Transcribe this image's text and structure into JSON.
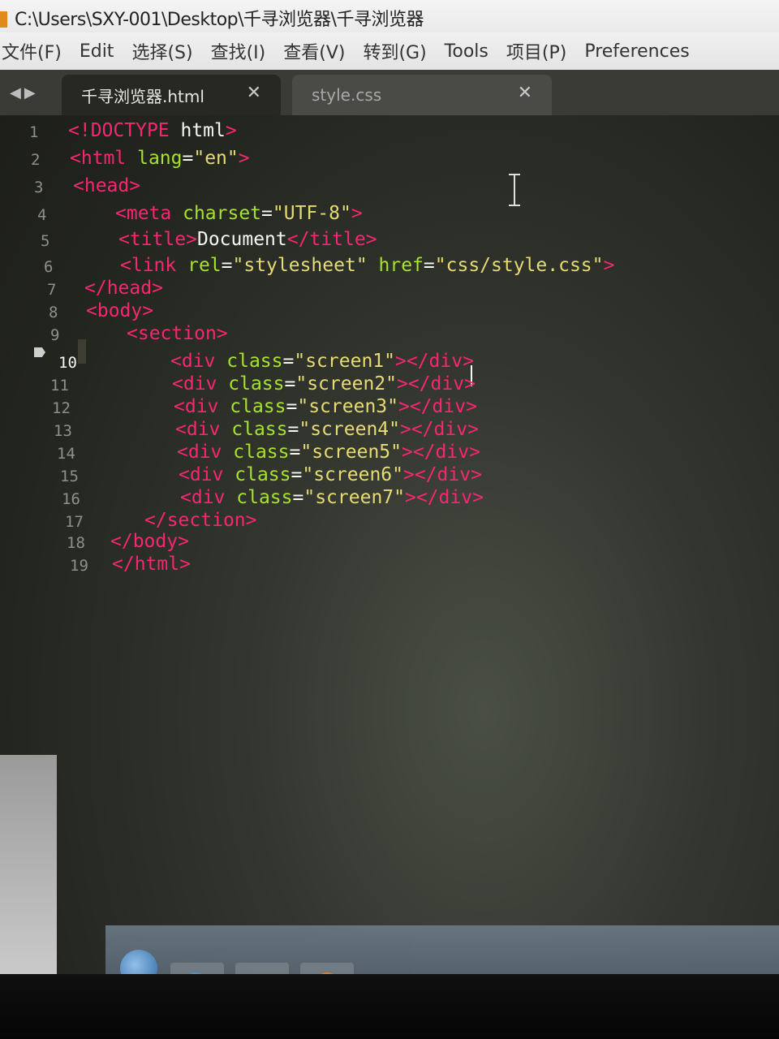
{
  "window": {
    "title": "C:\\Users\\SXY-001\\Desktop\\千寻浏览器\\千寻浏览器"
  },
  "menubar": {
    "items": [
      {
        "label": "文件(F)"
      },
      {
        "label": "Edit"
      },
      {
        "label": "选择(S)"
      },
      {
        "label": "查找(I)"
      },
      {
        "label": "查看(V)"
      },
      {
        "label": "转到(G)"
      },
      {
        "label": "Tools"
      },
      {
        "label": "项目(P)"
      },
      {
        "label": "Preferences"
      }
    ]
  },
  "tabs": [
    {
      "label": "千寻浏览器.html",
      "active": true,
      "close": "✕"
    },
    {
      "label": "style.css",
      "active": false,
      "close": "✕"
    }
  ],
  "tab_nav": {
    "left": "◀",
    "right": "▶"
  },
  "editor": {
    "current_line": 10,
    "lines": [
      {
        "n": "1",
        "tokens": [
          [
            "tag",
            "<!"
          ],
          [
            "tag",
            "DOCTYPE"
          ],
          [
            "txt",
            " html"
          ],
          [
            "tag",
            ">"
          ]
        ]
      },
      {
        "n": "2",
        "tokens": [
          [
            "tag",
            "<"
          ],
          [
            "tag",
            "html"
          ],
          [
            "attr",
            " lang"
          ],
          [
            "txt",
            "="
          ],
          [
            "str",
            "\"en\""
          ],
          [
            "tag",
            ">"
          ]
        ]
      },
      {
        "n": "3",
        "tokens": [
          [
            "tag",
            "<"
          ],
          [
            "tag",
            "head"
          ],
          [
            "tag",
            ">"
          ]
        ]
      },
      {
        "n": "4",
        "tokens": [
          [
            "tag",
            "<"
          ],
          [
            "tag",
            "meta"
          ],
          [
            "attr",
            " charset"
          ],
          [
            "txt",
            "="
          ],
          [
            "str",
            "\"UTF-8\""
          ],
          [
            "tag",
            ">"
          ]
        ]
      },
      {
        "n": "5",
        "tokens": [
          [
            "tag",
            "<"
          ],
          [
            "tag",
            "title"
          ],
          [
            "tag",
            ">"
          ],
          [
            "txt",
            "Document"
          ],
          [
            "tag",
            "</"
          ],
          [
            "tag",
            "title"
          ],
          [
            "tag",
            ">"
          ]
        ]
      },
      {
        "n": "6",
        "tokens": [
          [
            "tag",
            "<"
          ],
          [
            "tag",
            "link"
          ],
          [
            "attr",
            " rel"
          ],
          [
            "txt",
            "="
          ],
          [
            "str",
            "\"stylesheet\""
          ],
          [
            "attr",
            " href"
          ],
          [
            "txt",
            "="
          ],
          [
            "str",
            "\"css/style.css\""
          ],
          [
            "tag",
            ">"
          ]
        ]
      },
      {
        "n": "7",
        "tokens": [
          [
            "tag",
            "</"
          ],
          [
            "tag",
            "head"
          ],
          [
            "tag",
            ">"
          ]
        ]
      },
      {
        "n": "8",
        "tokens": [
          [
            "tag",
            "<"
          ],
          [
            "tag",
            "body"
          ],
          [
            "tag",
            ">"
          ]
        ]
      },
      {
        "n": "9",
        "tokens": [
          [
            "tag",
            "<"
          ],
          [
            "tag",
            "section"
          ],
          [
            "tag",
            ">"
          ]
        ]
      },
      {
        "n": "10",
        "tokens": [
          [
            "tag",
            "<"
          ],
          [
            "tag",
            "div"
          ],
          [
            "attr",
            " class"
          ],
          [
            "txt",
            "="
          ],
          [
            "str",
            "\"screen1\""
          ],
          [
            "tag",
            "></"
          ],
          [
            "tag",
            "div"
          ],
          [
            "tag",
            ">"
          ]
        ]
      },
      {
        "n": "11",
        "tokens": [
          [
            "tag",
            "<"
          ],
          [
            "tag",
            "div"
          ],
          [
            "attr",
            " class"
          ],
          [
            "txt",
            "="
          ],
          [
            "str",
            "\"screen2\""
          ],
          [
            "tag",
            "></"
          ],
          [
            "tag",
            "div"
          ],
          [
            "tag",
            ">"
          ]
        ]
      },
      {
        "n": "12",
        "tokens": [
          [
            "tag",
            "<"
          ],
          [
            "tag",
            "div"
          ],
          [
            "attr",
            " class"
          ],
          [
            "txt",
            "="
          ],
          [
            "str",
            "\"screen3\""
          ],
          [
            "tag",
            "></"
          ],
          [
            "tag",
            "div"
          ],
          [
            "tag",
            ">"
          ]
        ]
      },
      {
        "n": "13",
        "tokens": [
          [
            "tag",
            "<"
          ],
          [
            "tag",
            "div"
          ],
          [
            "attr",
            " class"
          ],
          [
            "txt",
            "="
          ],
          [
            "str",
            "\"screen4\""
          ],
          [
            "tag",
            "></"
          ],
          [
            "tag",
            "div"
          ],
          [
            "tag",
            ">"
          ]
        ]
      },
      {
        "n": "14",
        "tokens": [
          [
            "tag",
            "<"
          ],
          [
            "tag",
            "div"
          ],
          [
            "attr",
            " class"
          ],
          [
            "txt",
            "="
          ],
          [
            "str",
            "\"screen5\""
          ],
          [
            "tag",
            "></"
          ],
          [
            "tag",
            "div"
          ],
          [
            "tag",
            ">"
          ]
        ]
      },
      {
        "n": "15",
        "tokens": [
          [
            "tag",
            "<"
          ],
          [
            "tag",
            "div"
          ],
          [
            "attr",
            " class"
          ],
          [
            "txt",
            "="
          ],
          [
            "str",
            "\"screen6\""
          ],
          [
            "tag",
            "></"
          ],
          [
            "tag",
            "div"
          ],
          [
            "tag",
            ">"
          ]
        ]
      },
      {
        "n": "16",
        "tokens": [
          [
            "tag",
            "<"
          ],
          [
            "tag",
            "div"
          ],
          [
            "attr",
            " class"
          ],
          [
            "txt",
            "="
          ],
          [
            "str",
            "\"screen7\""
          ],
          [
            "tag",
            "></"
          ],
          [
            "tag",
            "div"
          ],
          [
            "tag",
            ">"
          ]
        ]
      },
      {
        "n": "17",
        "tokens": [
          [
            "tag",
            "</"
          ],
          [
            "tag",
            "section"
          ],
          [
            "tag",
            ">"
          ]
        ]
      },
      {
        "n": "18",
        "tokens": [
          [
            "tag",
            "</"
          ],
          [
            "tag",
            "body"
          ],
          [
            "tag",
            ">"
          ]
        ]
      },
      {
        "n": "19",
        "tokens": [
          [
            "tag",
            "</"
          ],
          [
            "tag",
            "html"
          ],
          [
            "tag",
            ">"
          ]
        ]
      }
    ]
  },
  "colors": {
    "editor_bg": "#272822",
    "tag": "#f92672",
    "attribute": "#a6e22e",
    "string": "#e6db74",
    "text": "#f8f8f2",
    "line_number": "#8f908a"
  },
  "icons": {
    "bookmark": "bookmark-icon",
    "cursor": "ibeam-cursor-icon",
    "start": "windows-start-icon",
    "taskbar": [
      "ie-icon",
      "folder-icon",
      "media-player-icon"
    ]
  }
}
